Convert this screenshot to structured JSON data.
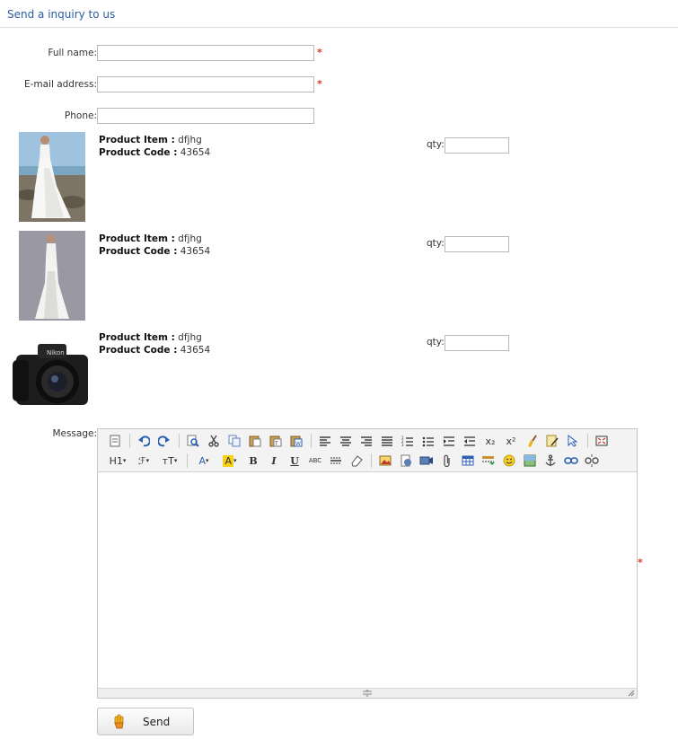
{
  "header": {
    "title": "Send a inquiry to us"
  },
  "form": {
    "full_name_label": "Full name:",
    "email_label": "E-mail address:",
    "phone_label": "Phone:",
    "required_mark": "*",
    "message_label": "Message:",
    "full_name_value": "",
    "email_value": "",
    "phone_value": ""
  },
  "products": [
    {
      "item_label": "Product Item :",
      "item_value": "dfjhg",
      "code_label": "Product Code :",
      "code_value": "43654",
      "qty_label": "qty:",
      "qty_value": "",
      "image": "wedding-dress-beach"
    },
    {
      "item_label": "Product Item :",
      "item_value": "dfjhg",
      "code_label": "Product Code :",
      "code_value": "43654",
      "qty_label": "qty:",
      "qty_value": "",
      "image": "wedding-dress-studio"
    },
    {
      "item_label": "Product Item :",
      "item_value": "dfjhg",
      "code_label": "Product Code :",
      "code_value": "43654",
      "qty_label": "qty:",
      "qty_value": "",
      "image": "nikon-camera",
      "brand_text": "Nikon"
    }
  ],
  "editor": {
    "toolbar_row1": [
      "source-icon",
      "undo-icon",
      "redo-icon",
      "preview-icon",
      "cut-icon",
      "copy-icon",
      "paste-icon",
      "paste-text-icon",
      "paste-word-icon",
      "align-left-icon",
      "align-center-icon",
      "align-right-icon",
      "align-justify-icon",
      "ordered-list-icon",
      "unordered-list-icon",
      "indent-icon",
      "outdent-icon",
      "subscript-icon",
      "superscript-icon",
      "clean-icon",
      "spellcheck-icon",
      "select-all-icon",
      "fullscreen-icon"
    ],
    "toolbar_row2": [
      "heading-icon",
      "font-family-icon",
      "font-size-icon",
      "font-color-icon",
      "highlight-icon",
      "bold-icon",
      "italic-icon",
      "underline-icon",
      "strikethrough-icon",
      "horizontal-rule-icon",
      "eraser-icon",
      "image-icon",
      "flash-icon",
      "media-icon",
      "attachment-icon",
      "table-icon",
      "page-break-icon",
      "emoticon-icon",
      "gallery-icon",
      "anchor-icon",
      "link-icon",
      "unlink-icon"
    ],
    "labels": {
      "heading": "H1",
      "font_family": "ℱ",
      "font_size": "тT",
      "font_color": "A",
      "highlight": "A",
      "bold": "B",
      "italic": "I",
      "underline": "U",
      "strike": "ABC",
      "subscript": "x₂",
      "superscript": "x²"
    },
    "content": ""
  },
  "send_button": {
    "label": "Send"
  },
  "colors": {
    "title": "#2a5d9f",
    "required": "#d9381e",
    "toolbar_bg": "#f3f3f3"
  }
}
